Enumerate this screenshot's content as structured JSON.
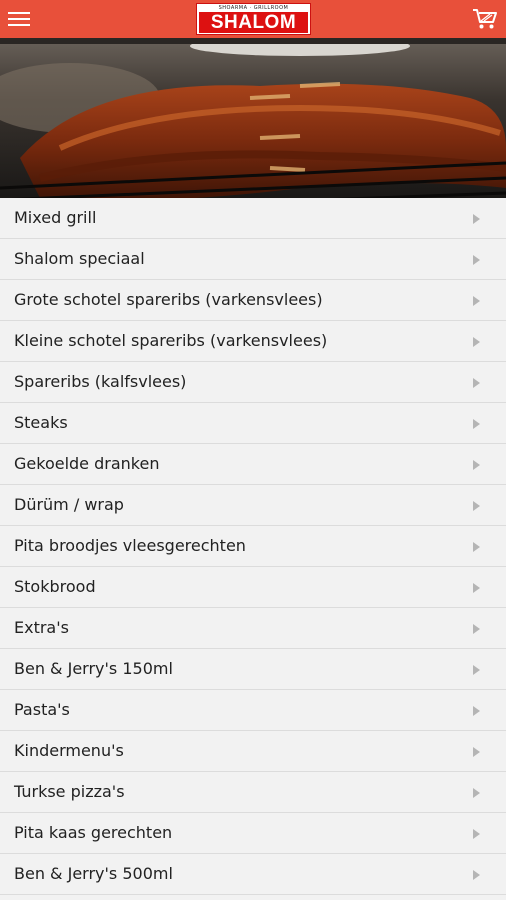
{
  "header": {
    "background_color": "#e8503a",
    "menu_icon": "hamburger-menu-icon",
    "cart_icon": "shopping-cart-icon",
    "logo": {
      "tagline": "SHOARMA · GRILLROOM",
      "name": "SHALOM"
    }
  },
  "hero": {
    "image": "grilled-spareribs-photo"
  },
  "menu": {
    "chevron_icon": "chevron-right-icon",
    "categories": [
      "Mixed grill",
      "Shalom speciaal",
      "Grote schotel spareribs (varkensvlees)",
      "Kleine schotel spareribs (varkensvlees)",
      "Spareribs (kalfsvlees)",
      "Steaks",
      "Gekoelde dranken",
      "Dürüm / wrap",
      "Pita broodjes vleesgerechten",
      "Stokbrood",
      "Extra's",
      "Ben & Jerry's 150ml",
      "Pasta's",
      "Kindermenu's",
      "Turkse pizza's",
      "Pita kaas gerechten",
      "Ben & Jerry's 500ml"
    ]
  }
}
